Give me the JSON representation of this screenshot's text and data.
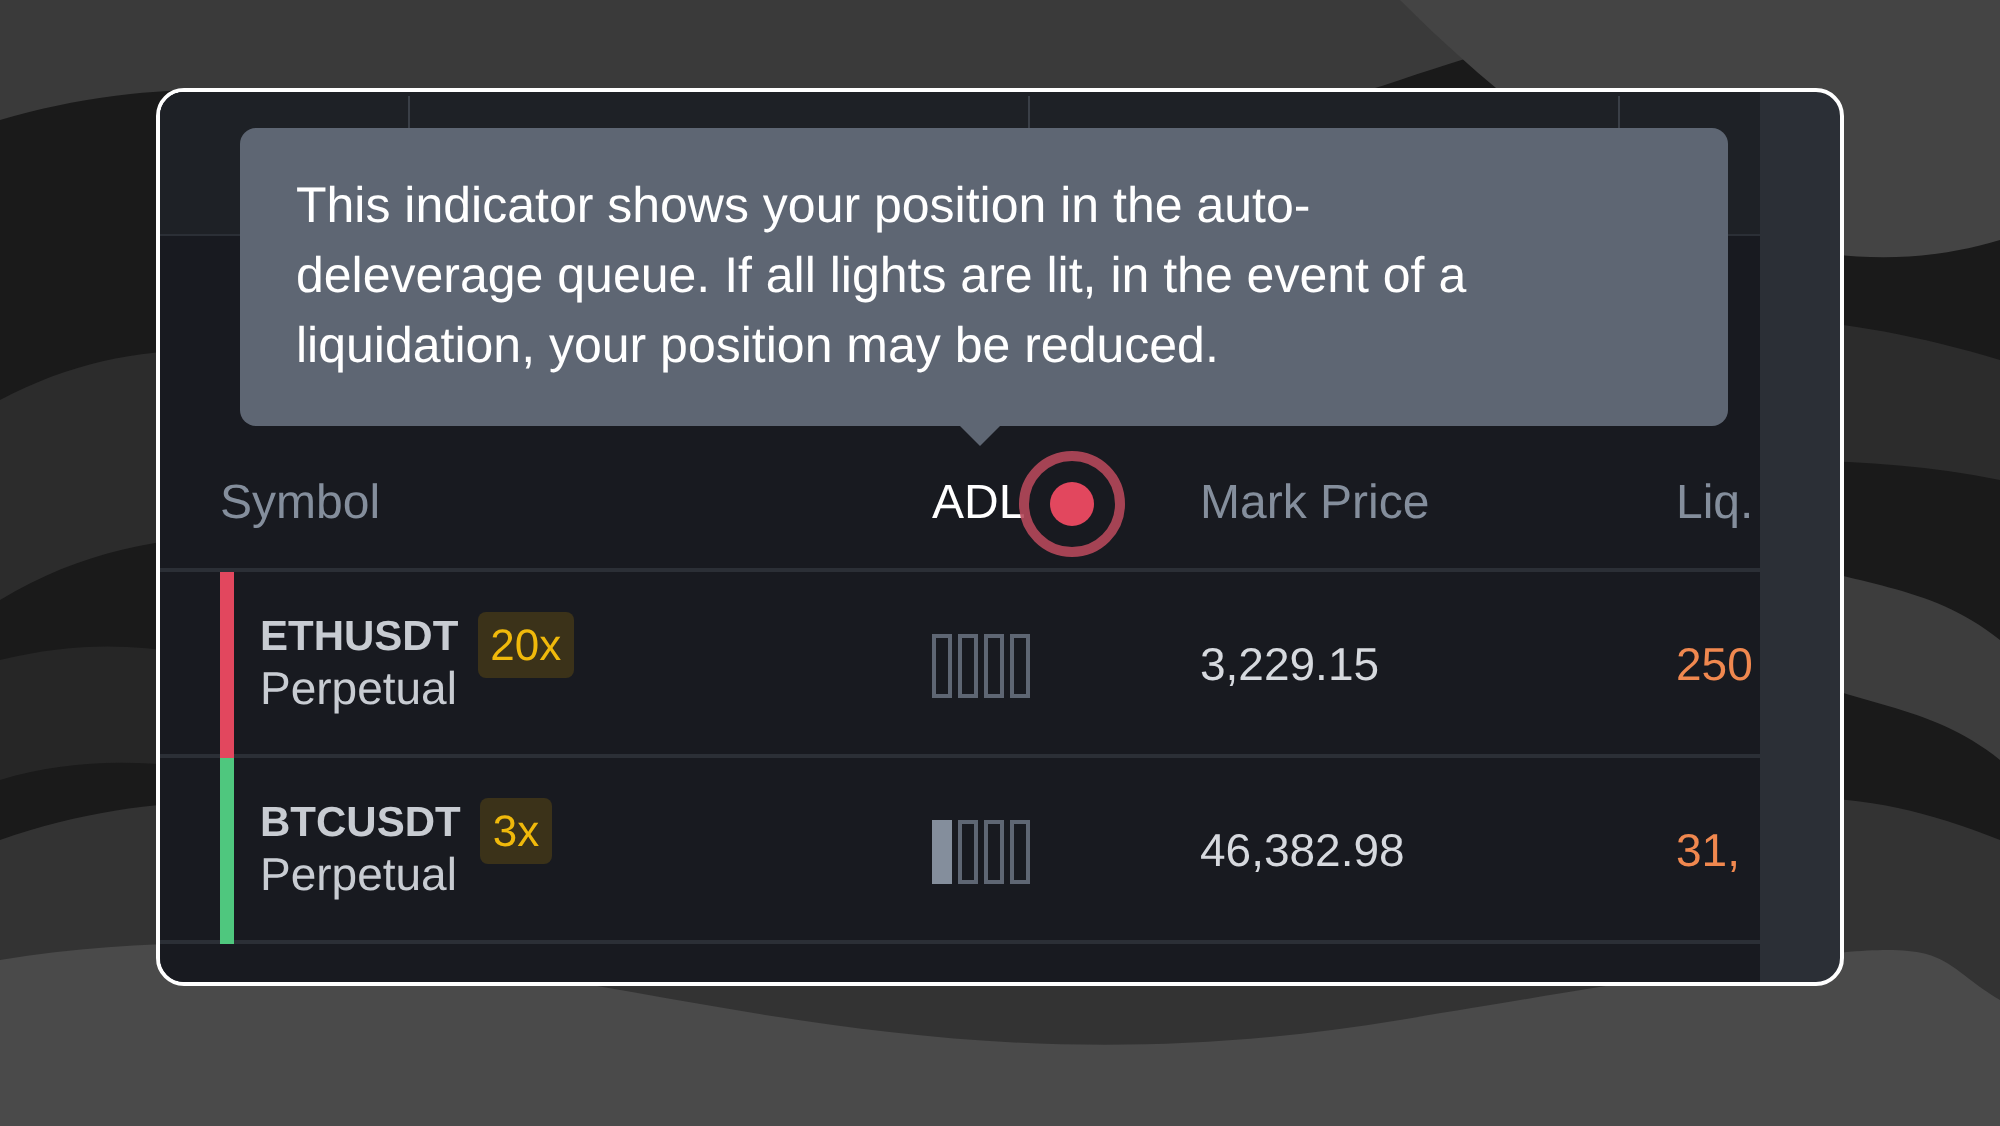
{
  "tooltip": {
    "text": "This indicator shows your position in the auto-deleverage queue. If all lights are lit, in the event of a liquidation, your position may be reduced."
  },
  "table": {
    "columns": [
      {
        "label": "Symbol",
        "highlighted": false
      },
      {
        "label": "ADL",
        "highlighted": true
      },
      {
        "label": "Mark Price",
        "highlighted": false
      },
      {
        "label": "Liq."
      }
    ],
    "rows": [
      {
        "symbol": "ETHUSDT",
        "contract": "Perpetual",
        "leverage": "20x",
        "color": "#e2475e",
        "adl_lights": [
          {
            "lit": false
          },
          {
            "lit": false
          },
          {
            "lit": false
          },
          {
            "lit": false
          }
        ],
        "mark_price": "3,229.15",
        "liq_price": "250"
      },
      {
        "symbol": "BTCUSDT",
        "contract": "Perpetual",
        "leverage": "3x",
        "color": "#4fc77e",
        "adl_lights": [
          {
            "lit": true
          },
          {
            "lit": false
          },
          {
            "lit": false
          },
          {
            "lit": false
          }
        ],
        "mark_price": "46,382.98",
        "liq_price": "31,"
      }
    ]
  }
}
